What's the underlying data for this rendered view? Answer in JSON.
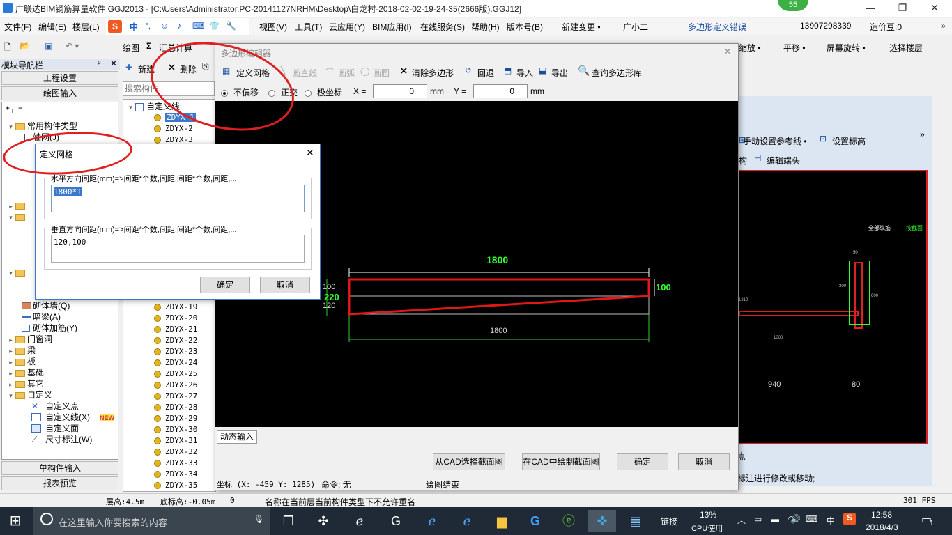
{
  "window": {
    "title": "广联达BIM钢筋算量软件 GGJ2013 - [C:\\Users\\Administrator.PC-20141127NRHM\\Desktop\\白龙村-2018-02-02-19-24-35(2666版).GGJ12]",
    "badge": "55"
  },
  "menu": {
    "items": [
      "文件(F)",
      "编辑(E)",
      "楼层(L)",
      "视图(V)",
      "工具(T)",
      "云应用(Y)",
      "BIM应用(I)",
      "在线服务(S)",
      "帮助(H)",
      "版本号(B)",
      "新建变更 •",
      "广小二"
    ],
    "ime": [
      "中",
      "°,",
      "☺",
      "♪",
      "⌨",
      "👕",
      "🔧"
    ],
    "error_text": "多边形定义错误",
    "phone": "13907298339",
    "price": "造价豆:0"
  },
  "toolbar1": {
    "draw": "绘图",
    "sum": "汇总计算",
    "right": [
      "缩放 •",
      "平移 •",
      "屏幕旋转 •",
      "选择楼层"
    ]
  },
  "nav": {
    "title": "模块导航栏",
    "project": "工程设置",
    "draw_input": "绘图输入",
    "single": "单构件输入",
    "report": "报表预览",
    "tree": [
      "常用构件类型",
      "轴网(J)",
      "砌体墙(Q)",
      "暗梁(A)",
      "砌体加筋(Y)",
      "门窗洞",
      "梁",
      "板",
      "基础",
      "其它",
      "自定义",
      "自定义点",
      "自定义线(X)",
      "自定义面",
      "尺寸标注(W)"
    ],
    "new_badge": "NEW"
  },
  "complist": {
    "new": "新建",
    "delete": "删除",
    "search_placeholder": "搜索构件...",
    "root": "自定义线",
    "items": [
      "ZDYX-1",
      "ZDYX-2",
      "ZDYX-3",
      "ZDYX-19",
      "ZDYX-20",
      "ZDYX-21",
      "ZDYX-22",
      "ZDYX-23",
      "ZDYX-24",
      "ZDYX-25",
      "ZDYX-26",
      "ZDYX-27",
      "ZDYX-28",
      "ZDYX-29",
      "ZDYX-30",
      "ZDYX-31",
      "ZDYX-32",
      "ZDYX-33",
      "ZDYX-34",
      "ZDYX-35"
    ]
  },
  "poly": {
    "title": "多边形编辑器",
    "tb": {
      "grid": "定义网格",
      "line": "画直线",
      "arc": "画弧",
      "circle": "画圆",
      "clear": "清除多边形",
      "undo": "回退",
      "import": "导入",
      "export": "导出",
      "query": "查询多边形库"
    },
    "opts": {
      "nooffset": "不偏移",
      "ortho": "正交",
      "polar": "极坐标",
      "x_label": "X =",
      "y_label": "Y =",
      "x": "0",
      "y": "0",
      "unit": "mm"
    },
    "dim": {
      "top": "1800",
      "bottom": "1800",
      "right": "100",
      "left": "220",
      "l1": "100",
      "l2": "120"
    },
    "dyn": "动态输入",
    "from_cad": "从CAD选择截面图",
    "draw_cad": "在CAD中绘制截面图",
    "ok": "确定",
    "cancel": "取消",
    "status": {
      "coord": "坐标 (X: -459 Y: 1285)",
      "cmd": "命令: 无",
      "end": "绘图结束"
    }
  },
  "grid_dlg": {
    "title": "定义网格",
    "h_label": "水平方向间距(mm)=>间距*个数,间距,间距*个数,间距,...",
    "h_value": "1800*1",
    "v_label": "垂直方向间距(mm)=>间距*个数,间距,间距*个数,间距,...",
    "v_value": "120,100",
    "ok": "确定",
    "cancel": "取消"
  },
  "rightpanel": {
    "ref": "手动设置参考线 •",
    "elev": "设置标高",
    "struct": "构",
    "edit_end": "编辑端头",
    "note": "全部纵筋",
    "note2": "按截面",
    "dims": [
      "940",
      "80",
      "1000",
      "1210",
      "50",
      "300",
      "600"
    ],
    "hint1": "点",
    "hint2": "标注进行修改或移动;"
  },
  "status": {
    "floor_h": "层高:4.5m",
    "base_h": "底标高:-0.05m",
    "zero": "0",
    "msg": "名称在当前层当前构件类型下不允许重名",
    "fps": "301 FPS"
  },
  "taskbar": {
    "search": "在这里输入你要搜索的内容",
    "link": "链接",
    "cpu": "13%",
    "cpu_label": "CPU使用",
    "lang": "中",
    "time": "12:58",
    "date": "2018/4/3",
    "notif": "1"
  }
}
